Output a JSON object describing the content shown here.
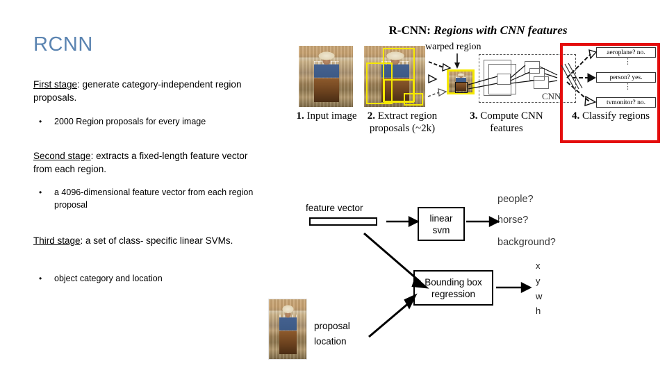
{
  "slide": {
    "title": "RCNN",
    "title_color": "#5b84b1",
    "background": "#ffffff"
  },
  "left_column": {
    "stage1": {
      "lead": "First stage",
      "rest": ": generate category-independent region proposals."
    },
    "bullet1": "2000 Region proposals for every image",
    "stage2": {
      "lead": "Second stage",
      "rest": ": extracts a fixed-length feature vector from each region."
    },
    "bullet2": "a 4096-dimensional feature vector from each region proposal",
    "stage3": {
      "lead": "Third stage",
      "rest": ": a set of class- specific linear SVMs."
    },
    "bullet3": "object category  and location"
  },
  "rcnn_figure": {
    "title_plain": "R-CNN: ",
    "title_italic": "Regions with CNN features",
    "warped_region_label": "warped region",
    "cnn_label": "CNN",
    "class_boxes": [
      "aeroplane? no.",
      "person? yes.",
      "tvmonitor? no."
    ],
    "captions": [
      {
        "num": "1.",
        "text": "Input image"
      },
      {
        "num": "2.",
        "text": "Extract region proposals (~2k)"
      },
      {
        "num": "3.",
        "text": "Compute CNN features"
      },
      {
        "num": "4.",
        "text": "Classify regions"
      }
    ],
    "highlight_color": "#e40d0d",
    "proposal_box_color": "#f5e800"
  },
  "flow_diagram": {
    "feature_vector_label": "feature vector",
    "linear_svm_label_line1": "linear",
    "linear_svm_label_line2": "svm",
    "bounding_box_label_line1": "Bounding box",
    "bounding_box_label_line2": "regression",
    "answers": [
      "people?",
      "horse?",
      "background?"
    ],
    "coords": [
      "x",
      "y",
      "w",
      "h"
    ],
    "proposal_location_line1": "proposal",
    "proposal_location_line2": "location",
    "answer_color": "#3a3a3a"
  }
}
